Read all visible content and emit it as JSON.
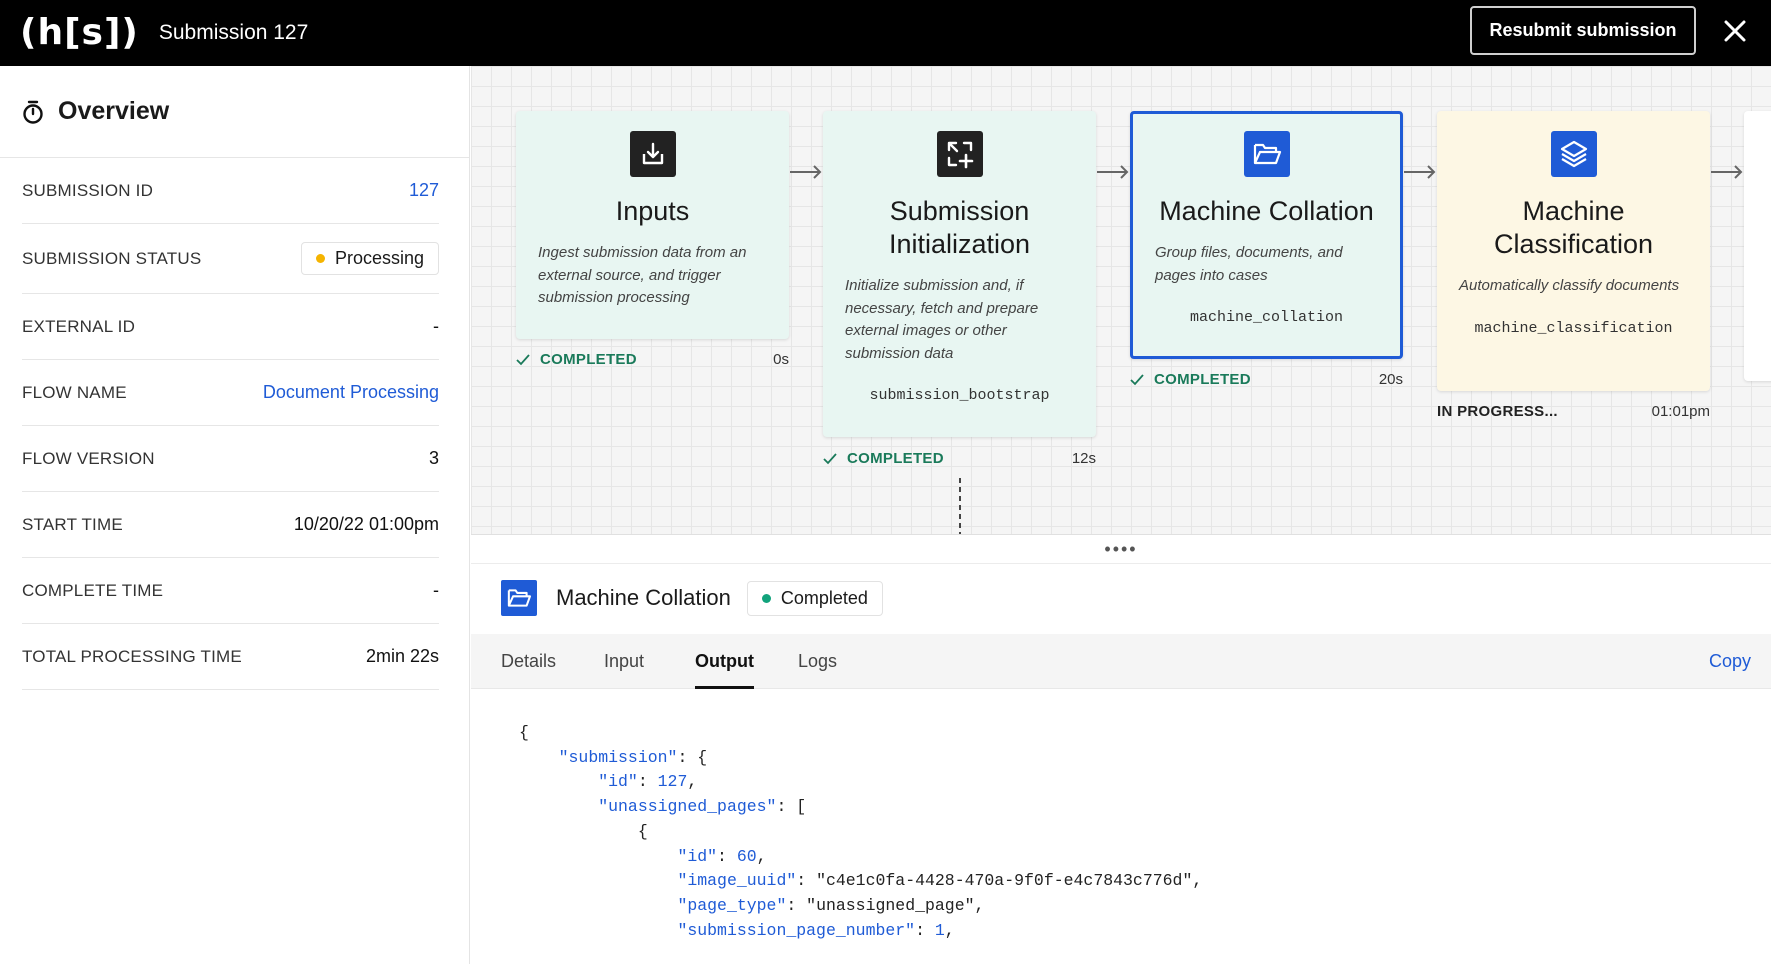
{
  "app": {
    "logo": "(h[s])",
    "title": "Submission 127",
    "resubmit_label": "Resubmit submission"
  },
  "overview": {
    "title": "Overview",
    "rows": [
      {
        "label": "SUBMISSION ID",
        "value": "127"
      },
      {
        "label": "SUBMISSION STATUS",
        "value": "Processing"
      },
      {
        "label": "EXTERNAL ID",
        "value": "-"
      },
      {
        "label": "FLOW NAME",
        "value": "Document Processing"
      },
      {
        "label": "FLOW VERSION",
        "value": "3"
      },
      {
        "label": "START TIME",
        "value": "10/20/22 01:00pm"
      },
      {
        "label": "COMPLETE TIME",
        "value": "-"
      },
      {
        "label": "TOTAL PROCESSING TIME",
        "value": "2min 22s"
      }
    ]
  },
  "flow": {
    "blocks": [
      {
        "title": "Inputs",
        "description": "Ingest submission data from an external source, and trigger submission processing",
        "code": "",
        "status": "COMPLETED",
        "duration": "0s",
        "icon": "download-icon"
      },
      {
        "title": "Submission Initialization",
        "description": "Initialize submission and, if necessary, fetch and prepare external images or other submission data",
        "code": "submission_bootstrap",
        "status": "COMPLETED",
        "duration": "12s",
        "icon": "transform-plus-icon"
      },
      {
        "title": "Machine Collation",
        "description": "Group files, documents, and pages into cases",
        "code": "machine_collation",
        "status": "COMPLETED",
        "duration": "20s",
        "icon": "folder-open-icon"
      },
      {
        "title": "Machine Classification",
        "description": "Automatically classify documents",
        "code": "machine_classification",
        "status": "IN PROGRESS...",
        "duration": "01:01pm",
        "icon": "layers-icon"
      }
    ]
  },
  "detail": {
    "title": "Machine Collation",
    "status": "Completed",
    "tabs": [
      "Details",
      "Input",
      "Output",
      "Logs"
    ],
    "active_tab": "Output",
    "copy_label": "Copy",
    "output": {
      "open_brace": "{",
      "submission_key": "\"submission\"",
      "id_key": "\"id\"",
      "id_value": "127",
      "unassigned_key": "\"unassigned_pages\"",
      "page": {
        "id_key": "\"id\"",
        "id_value": "60",
        "image_uuid_key": "\"image_uuid\"",
        "image_uuid_value": "\"c4e1c0fa-4428-470a-9f0f-e4c7843c776d\"",
        "page_type_key": "\"page_type\"",
        "page_type_value": "\"unassigned_page\"",
        "page_number_key": "\"submission_page_number\"",
        "page_number_value": "1"
      }
    }
  },
  "colors": {
    "accent": "#1f5bd6",
    "completed": "#1a7a5a",
    "processing_dot": "#f5b400",
    "completed_dot": "#12a37c",
    "block_teal": "#e8f6f2",
    "block_yellow": "#fdf7e4"
  }
}
